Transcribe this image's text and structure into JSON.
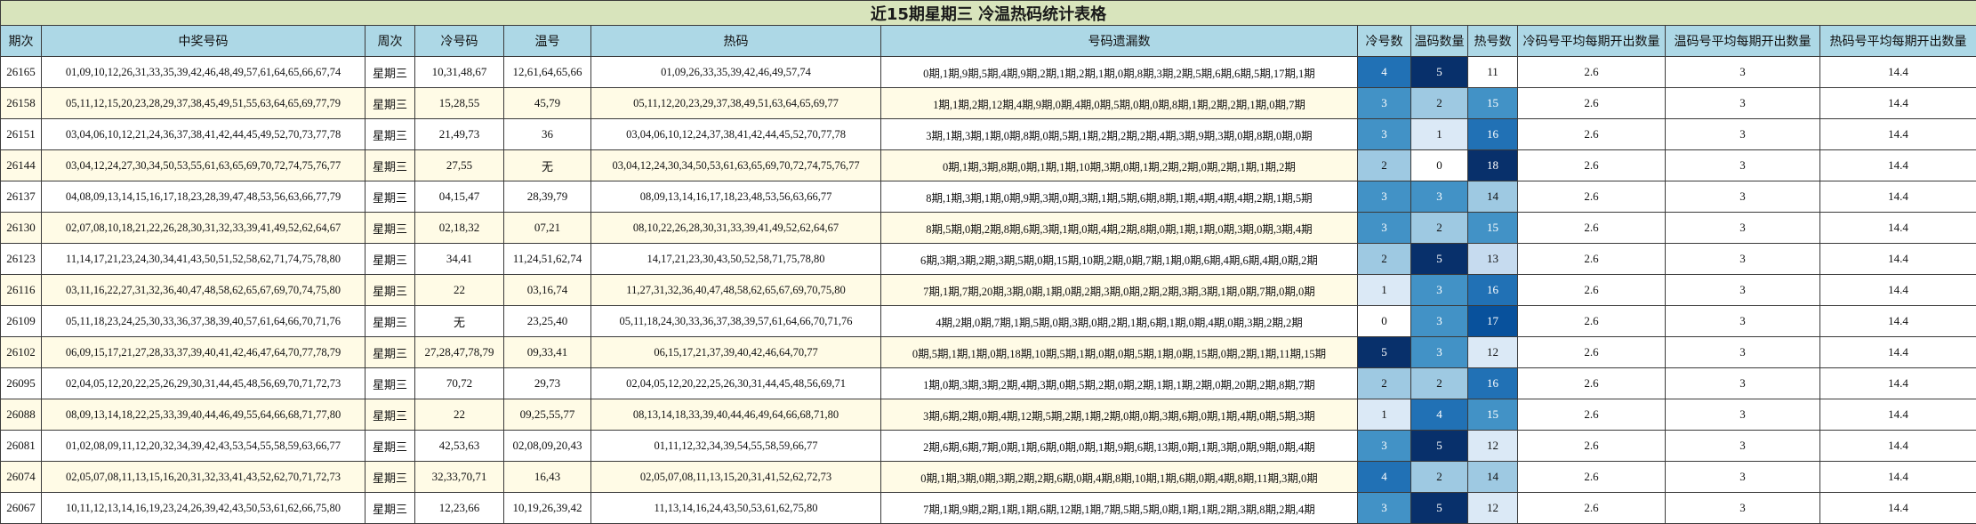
{
  "title": "近15期星期三 冷温热码统计表格",
  "headers": [
    "期次",
    "中奖号码",
    "周次",
    "冷号码",
    "温号",
    "热码",
    "号码遗漏数",
    "冷号数",
    "温码数量",
    "热号数",
    "冷码号平均每期开出数量",
    "温码号平均每期开出数量",
    "热码号平均每期开出数量"
  ],
  "rows": [
    {
      "period": "26165",
      "numbers": "01,09,10,12,26,31,33,35,39,42,46,48,49,57,61,64,65,66,67,74",
      "week": "星期三",
      "cold": "10,31,48,67",
      "warm": "12,61,64,65,66",
      "hot": "01,09,26,33,35,39,42,46,49,57,74",
      "omit": "0期,1期,9期,5期,4期,9期,2期,1期,2期,1期,0期,8期,3期,2期,5期,6期,6期,5期,17期,1期",
      "cold_n": "4",
      "warm_n": "5",
      "hot_n": "11",
      "cold_avg": "2.6",
      "warm_avg": "3",
      "hot_avg": "14.4"
    },
    {
      "period": "26158",
      "numbers": "05,11,12,15,20,23,28,29,37,38,45,49,51,55,63,64,65,69,77,79",
      "week": "星期三",
      "cold": "15,28,55",
      "warm": "45,79",
      "hot": "05,11,12,20,23,29,37,38,49,51,63,64,65,69,77",
      "omit": "1期,1期,2期,12期,4期,9期,0期,4期,0期,5期,0期,0期,8期,1期,2期,2期,1期,0期,7期",
      "cold_n": "3",
      "warm_n": "2",
      "hot_n": "15",
      "cold_avg": "2.6",
      "warm_avg": "3",
      "hot_avg": "14.4"
    },
    {
      "period": "26151",
      "numbers": "03,04,06,10,12,21,24,36,37,38,41,42,44,45,49,52,70,73,77,78",
      "week": "星期三",
      "cold": "21,49,73",
      "warm": "36",
      "hot": "03,04,06,10,12,24,37,38,41,42,44,45,52,70,77,78",
      "omit": "3期,1期,3期,1期,0期,8期,0期,5期,1期,2期,2期,2期,4期,3期,9期,3期,0期,8期,0期,0期",
      "cold_n": "3",
      "warm_n": "1",
      "hot_n": "16",
      "cold_avg": "2.6",
      "warm_avg": "3",
      "hot_avg": "14.4"
    },
    {
      "period": "26144",
      "numbers": "03,04,12,24,27,30,34,50,53,55,61,63,65,69,70,72,74,75,76,77",
      "week": "星期三",
      "cold": "27,55",
      "warm": "无",
      "hot": "03,04,12,24,30,34,50,53,61,63,65,69,70,72,74,75,76,77",
      "omit": "0期,1期,3期,8期,0期,1期,1期,10期,3期,0期,1期,2期,2期,0期,2期,1期,1期,2期",
      "cold_n": "2",
      "warm_n": "0",
      "hot_n": "18",
      "cold_avg": "2.6",
      "warm_avg": "3",
      "hot_avg": "14.4"
    },
    {
      "period": "26137",
      "numbers": "04,08,09,13,14,15,16,17,18,23,28,39,47,48,53,56,63,66,77,79",
      "week": "星期三",
      "cold": "04,15,47",
      "warm": "28,39,79",
      "hot": "08,09,13,14,16,17,18,23,48,53,56,63,66,77",
      "omit": "8期,1期,3期,1期,0期,9期,3期,0期,3期,1期,5期,6期,8期,1期,4期,4期,4期,2期,1期,5期",
      "cold_n": "3",
      "warm_n": "3",
      "hot_n": "14",
      "cold_avg": "2.6",
      "warm_avg": "3",
      "hot_avg": "14.4"
    },
    {
      "period": "26130",
      "numbers": "02,07,08,10,18,21,22,26,28,30,31,32,33,39,41,49,52,62,64,67",
      "week": "星期三",
      "cold": "02,18,32",
      "warm": "07,21",
      "hot": "08,10,22,26,28,30,31,33,39,41,49,52,62,64,67",
      "omit": "8期,5期,0期,2期,8期,6期,3期,1期,0期,4期,2期,8期,0期,1期,1期,0期,3期,0期,3期,4期",
      "cold_n": "3",
      "warm_n": "2",
      "hot_n": "15",
      "cold_avg": "2.6",
      "warm_avg": "3",
      "hot_avg": "14.4"
    },
    {
      "period": "26123",
      "numbers": "11,14,17,21,23,24,30,34,41,43,50,51,52,58,62,71,74,75,78,80",
      "week": "星期三",
      "cold": "34,41",
      "warm": "11,24,51,62,74",
      "hot": "14,17,21,23,30,43,50,52,58,71,75,78,80",
      "omit": "6期,3期,3期,2期,3期,5期,0期,15期,10期,2期,0期,7期,1期,0期,6期,4期,6期,4期,0期,2期",
      "cold_n": "2",
      "warm_n": "5",
      "hot_n": "13",
      "cold_avg": "2.6",
      "warm_avg": "3",
      "hot_avg": "14.4"
    },
    {
      "period": "26116",
      "numbers": "03,11,16,22,27,31,32,36,40,47,48,58,62,65,67,69,70,74,75,80",
      "week": "星期三",
      "cold": "22",
      "warm": "03,16,74",
      "hot": "11,27,31,32,36,40,47,48,58,62,65,67,69,70,75,80",
      "omit": "7期,1期,7期,20期,3期,0期,1期,0期,2期,3期,0期,2期,2期,3期,3期,1期,0期,7期,0期,0期",
      "cold_n": "1",
      "warm_n": "3",
      "hot_n": "16",
      "cold_avg": "2.6",
      "warm_avg": "3",
      "hot_avg": "14.4"
    },
    {
      "period": "26109",
      "numbers": "05,11,18,23,24,25,30,33,36,37,38,39,40,57,61,64,66,70,71,76",
      "week": "星期三",
      "cold": "无",
      "warm": "23,25,40",
      "hot": "05,11,18,24,30,33,36,37,38,39,57,61,64,66,70,71,76",
      "omit": "4期,2期,0期,7期,1期,5期,0期,3期,0期,2期,1期,6期,1期,0期,4期,0期,3期,2期,2期",
      "cold_n": "0",
      "warm_n": "3",
      "hot_n": "17",
      "cold_avg": "2.6",
      "warm_avg": "3",
      "hot_avg": "14.4"
    },
    {
      "period": "26102",
      "numbers": "06,09,15,17,21,27,28,33,37,39,40,41,42,46,47,64,70,77,78,79",
      "week": "星期三",
      "cold": "27,28,47,78,79",
      "warm": "09,33,41",
      "hot": "06,15,17,21,37,39,40,42,46,64,70,77",
      "omit": "0期,5期,1期,1期,0期,18期,10期,5期,1期,0期,0期,5期,1期,0期,15期,0期,2期,1期,11期,15期",
      "cold_n": "5",
      "warm_n": "3",
      "hot_n": "12",
      "cold_avg": "2.6",
      "warm_avg": "3",
      "hot_avg": "14.4"
    },
    {
      "period": "26095",
      "numbers": "02,04,05,12,20,22,25,26,29,30,31,44,45,48,56,69,70,71,72,73",
      "week": "星期三",
      "cold": "70,72",
      "warm": "29,73",
      "hot": "02,04,05,12,20,22,25,26,30,31,44,45,48,56,69,71",
      "omit": "1期,0期,3期,3期,2期,4期,3期,0期,5期,2期,0期,2期,1期,1期,2期,0期,20期,2期,8期,7期",
      "cold_n": "2",
      "warm_n": "2",
      "hot_n": "16",
      "cold_avg": "2.6",
      "warm_avg": "3",
      "hot_avg": "14.4"
    },
    {
      "period": "26088",
      "numbers": "08,09,13,14,18,22,25,33,39,40,44,46,49,55,64,66,68,71,77,80",
      "week": "星期三",
      "cold": "22",
      "warm": "09,25,55,77",
      "hot": "08,13,14,18,33,39,40,44,46,49,64,66,68,71,80",
      "omit": "3期,6期,2期,0期,4期,12期,5期,2期,1期,2期,0期,0期,3期,6期,0期,1期,4期,0期,5期,3期",
      "cold_n": "1",
      "warm_n": "4",
      "hot_n": "15",
      "cold_avg": "2.6",
      "warm_avg": "3",
      "hot_avg": "14.4"
    },
    {
      "period": "26081",
      "numbers": "01,02,08,09,11,12,20,32,34,39,42,43,53,54,55,58,59,63,66,77",
      "week": "星期三",
      "cold": "42,53,63",
      "warm": "02,08,09,20,43",
      "hot": "01,11,12,32,34,39,54,55,58,59,66,77",
      "omit": "2期,6期,6期,7期,0期,1期,6期,0期,0期,1期,9期,6期,13期,0期,1期,3期,0期,9期,0期,4期",
      "cold_n": "3",
      "warm_n": "5",
      "hot_n": "12",
      "cold_avg": "2.6",
      "warm_avg": "3",
      "hot_avg": "14.4"
    },
    {
      "period": "26074",
      "numbers": "02,05,07,08,11,13,15,16,20,31,32,33,41,43,52,62,70,71,72,73",
      "week": "星期三",
      "cold": "32,33,70,71",
      "warm": "16,43",
      "hot": "02,05,07,08,11,13,15,20,31,41,52,62,72,73",
      "omit": "0期,1期,3期,0期,3期,2期,2期,6期,0期,4期,8期,10期,1期,6期,0期,4期,8期,11期,3期,0期",
      "cold_n": "4",
      "warm_n": "2",
      "hot_n": "14",
      "cold_avg": "2.6",
      "warm_avg": "3",
      "hot_avg": "14.4"
    },
    {
      "period": "26067",
      "numbers": "10,11,12,13,14,16,19,23,24,26,39,42,43,50,53,61,62,66,75,80",
      "week": "星期三",
      "cold": "12,23,66",
      "warm": "10,19,26,39,42",
      "hot": "11,13,14,16,24,43,50,53,61,62,75,80",
      "omit": "7期,1期,9期,2期,1期,1期,6期,12期,1期,7期,5期,5期,0期,1期,1期,2期,3期,8期,2期,4期",
      "cold_n": "3",
      "warm_n": "5",
      "hot_n": "12",
      "cold_avg": "2.6",
      "warm_avg": "3",
      "hot_avg": "14.4"
    }
  ],
  "colors": {
    "title_bg": "#d8e4bc",
    "header_bg": "#add8e6",
    "row_alt_bg": "#fffbe6",
    "scale": {
      "0": "#ffffff",
      "1": "#dbe9f6",
      "2": "#9ec9e2",
      "3": "#4292c6",
      "4": "#2171b5",
      "5": "#08306b",
      "11": "#ffffff",
      "12": "#dbe9f6",
      "13": "#c6dbef",
      "14": "#9ec9e2",
      "15": "#4292c6",
      "16": "#2171b5",
      "17": "#08519c",
      "18": "#08306b"
    }
  }
}
